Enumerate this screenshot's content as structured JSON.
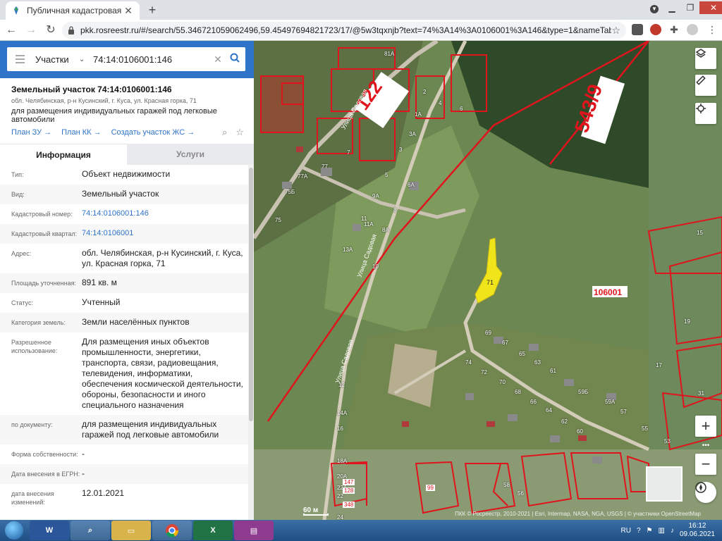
{
  "browser": {
    "tab_title": "Публичная кадастровая карта",
    "url": "pkk.rosreestr.ru/#/search/55.346721059062496,59.45497694821723/17/@5w3tqxnjb?text=74%3A14%3A0106001%3A146&type=1&nameTab&inde..."
  },
  "search": {
    "type": "Участки",
    "value": "74:14:0106001:146"
  },
  "object": {
    "title": "Земельный участок 74:14:0106001:146",
    "address": "обл. Челябинская, р-н Кусинский, г. Куса, ул. Красная горка, 71",
    "use": "для размещения индивидуальных гаражей под легковые автомобили",
    "links": [
      "План ЗУ →",
      "План КК →",
      "Создать участок ЖС →"
    ]
  },
  "tabs": {
    "info": "Информация",
    "services": "Услуги"
  },
  "rows": [
    {
      "k": "Тип:",
      "v": "Объект недвижимости"
    },
    {
      "k": "Вид:",
      "v": "Земельный участок"
    },
    {
      "k": "Кадастровый номер:",
      "v": "74:14:0106001:146",
      "link": true
    },
    {
      "k": "Кадастровый квартал:",
      "v": "74:14:0106001",
      "link": true
    },
    {
      "k": "Адрес:",
      "v": "обл. Челябинская, р-н Кусинский, г. Куса, ул. Красная горка, 71"
    },
    {
      "k": "Площадь уточненная:",
      "v": "891 кв. м"
    },
    {
      "k": "Статус:",
      "v": "Учтенный"
    },
    {
      "k": "Категория земель:",
      "v": "Земли населённых пунктов"
    },
    {
      "k": "Разрешенное использование:",
      "v": "Для размещения иных объектов промышленности, энергетики, транспорта, связи, радиовещания, телевидения, информатики, обеспечения космической деятельности, обороны, безопасности и иного специального назначения"
    },
    {
      "k": "по документу:",
      "v": "для размещения индивидуальных гаражей под легковые автомобили"
    },
    {
      "k": "Форма собственности:",
      "v": "-"
    },
    {
      "k": "Дата внесения в ЕГРН:",
      "v": "-"
    },
    {
      "k": "дата внесения изменений:",
      "v": "12.01.2021"
    }
  ],
  "map": {
    "labels": {
      "l122": "122",
      "l543": "543/9",
      "l106001": "106001",
      "l71": "71",
      "street1": "Улица Садовая",
      "street2": "Улица Садовая",
      "street3": "Улица Садовая"
    },
    "small_labels": [
      "81А",
      "2",
      "4",
      "6",
      "1А",
      "3А",
      "3",
      "7",
      "77",
      "77А",
      "5",
      "6А",
      "9А",
      "75Б",
      "8",
      "11",
      "11А",
      "8А",
      "75",
      "13А",
      "10",
      "69",
      "67",
      "65",
      "63",
      "61",
      "74",
      "72",
      "70",
      "68",
      "66",
      "64",
      "62",
      "60",
      "59Б",
      "59А",
      "57",
      "55",
      "58",
      "56",
      "12",
      "14А",
      "16",
      "18А",
      "20А",
      "22А",
      "22",
      "24",
      "15",
      "31",
      "53",
      "17",
      "19"
    ],
    "red_labels": [
      "147",
      "128",
      "348",
      "99"
    ],
    "scale": "60 м",
    "attribution": "ПКК © Росреестр, 2010-2021 | Esri, Intermap, NASA, NGA, USGS | © участники OpenStreetMap",
    "controls": [
      "layers-icon",
      "ruler-icon",
      "locate-icon",
      "zoom-in",
      "more",
      "zoom-out",
      "compass-icon"
    ],
    "zoom_in": "+",
    "zoom_out": "−",
    "more": "•••"
  },
  "taskbar": {
    "lang": "RU",
    "time": "16:12",
    "date": "09.06.2021"
  },
  "colors": {
    "accent": "#2e74c8",
    "parcel": "#e0141c",
    "selected": "#f0e41a"
  }
}
